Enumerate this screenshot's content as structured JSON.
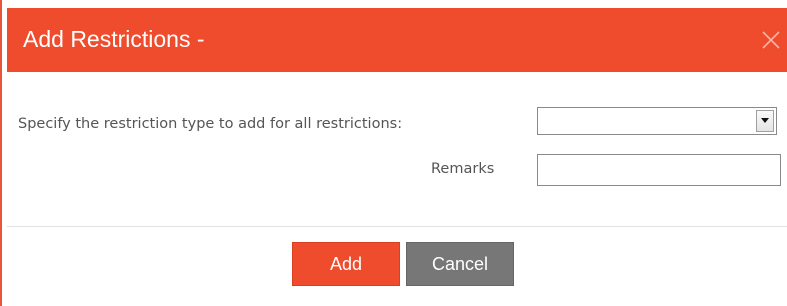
{
  "dialog": {
    "title": "Add Restrictions -",
    "close_icon": "close-icon",
    "accent_color": "#ee4c2c"
  },
  "form": {
    "restriction_type_label": "Specify the restriction type to add for all restrictions:",
    "restriction_type_value": "",
    "restriction_type_icon": "dropdown-arrow-icon",
    "remarks_label": "Remarks",
    "remarks_value": ""
  },
  "buttons": {
    "add_label": "Add",
    "cancel_label": "Cancel",
    "add_color": "#ee4c2c",
    "cancel_color": "#777777"
  }
}
